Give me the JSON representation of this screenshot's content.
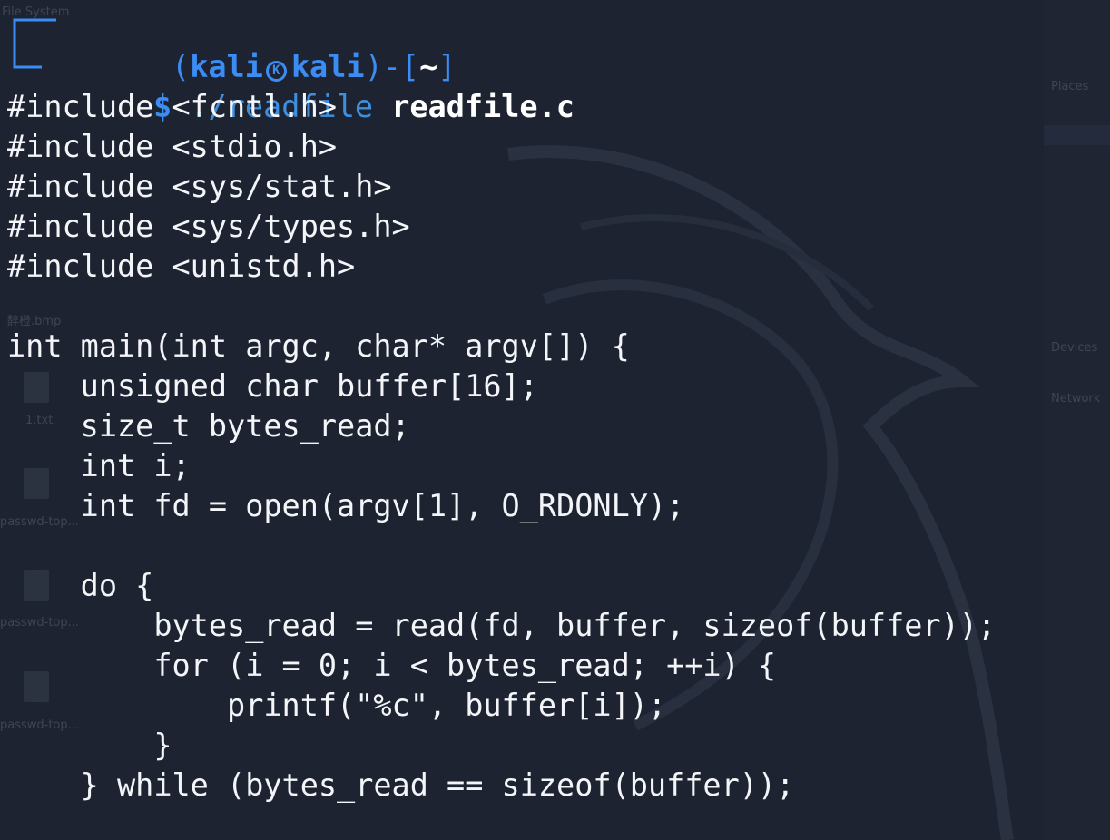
{
  "desktop": {
    "file_system_label": "File System",
    "bmp_label": "醉橙.bmp",
    "file1_label": "1.txt",
    "file2_label": "passwd-top...",
    "file3_label": "passwd-top...",
    "file4_label": "passwd-top...",
    "sidebar": {
      "places_label": "Places",
      "devices_label": "Devices",
      "network_label": "Network"
    }
  },
  "terminal": {
    "prompt": {
      "user": "kali",
      "host": "kali",
      "cwd": "~",
      "dollar": "$",
      "command": "./readfile",
      "argument": "readfile.c"
    },
    "output_lines": [
      "#include <fcntl.h>",
      "#include <stdio.h>",
      "#include <sys/stat.h>",
      "#include <sys/types.h>",
      "#include <unistd.h>",
      "",
      "int main(int argc, char* argv[]) {",
      "    unsigned char buffer[16];",
      "    size_t bytes_read;",
      "    int i;",
      "    int fd = open(argv[1], O_RDONLY);",
      "",
      "    do {",
      "        bytes_read = read(fd, buffer, sizeof(buffer));",
      "        for (i = 0; i < bytes_read; ++i) {",
      "            printf(\"%c\", buffer[i]);",
      "        }",
      "    } while (bytes_read == sizeof(buffer));"
    ]
  },
  "colors": {
    "background": "#1d2330",
    "prompt_blue": "#3b8df5",
    "text": "#f3f5f8"
  }
}
